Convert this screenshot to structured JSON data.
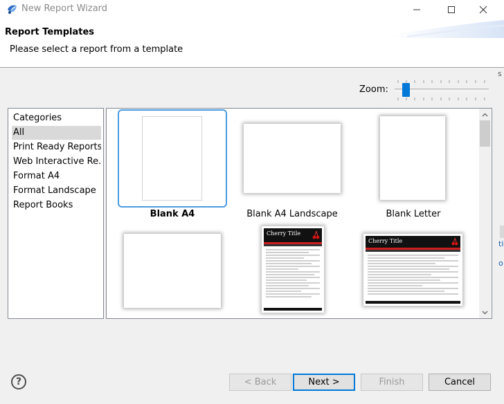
{
  "window": {
    "title": "New Report Wizard",
    "minimize_label": "Minimize",
    "maximize_label": "Maximize",
    "close_label": "Close"
  },
  "header": {
    "title": "Report Templates",
    "description": "Please select a report from a template"
  },
  "zoom": {
    "label": "Zoom:",
    "level": 0.09
  },
  "categories": {
    "header": "Categories",
    "items": [
      {
        "label": "All",
        "selected": true
      },
      {
        "label": "Print Ready Reports",
        "selected": false
      },
      {
        "label": "Web Interactive Re...",
        "selected": false
      },
      {
        "label": "Format A4",
        "selected": false
      },
      {
        "label": "Format Landscape",
        "selected": false
      },
      {
        "label": "Report Books",
        "selected": false
      }
    ]
  },
  "templates": [
    {
      "label": "Blank A4",
      "selected": true
    },
    {
      "label": "Blank A4 Landscape",
      "selected": false
    },
    {
      "label": "Blank Letter",
      "selected": false
    },
    {
      "label": "",
      "selected": false
    },
    {
      "label": "",
      "selected": false,
      "preview_title": "Cherry Title"
    },
    {
      "label": "",
      "selected": false,
      "preview_title": "Cherry Title"
    }
  ],
  "buttons": {
    "help": "?",
    "back": "< Back",
    "next": "Next >",
    "finish": "Finish",
    "cancel": "Cancel"
  },
  "colors": {
    "accent": "#0078d7",
    "selection_border": "#4a9be0",
    "cherry_red": "#cc1f1f"
  }
}
